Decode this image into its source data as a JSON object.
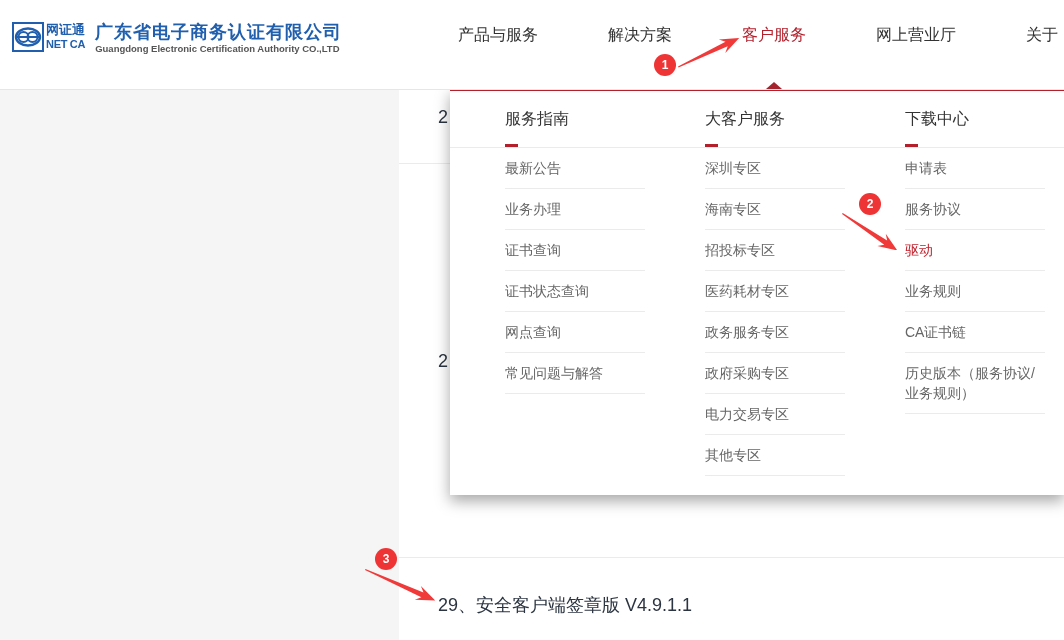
{
  "header": {
    "logo": {
      "mark_cn": "网证通",
      "mark_en": "NET CA",
      "name": "广东省电子商务认证有限公司",
      "name_en": "Guangdong Electronic Certification Authority CO.,LTD"
    },
    "nav": [
      {
        "label": "产品与服务",
        "selected": false
      },
      {
        "label": "解决方案",
        "selected": false
      },
      {
        "label": "客户服务",
        "selected": true
      },
      {
        "label": "网上营业厅",
        "selected": false
      },
      {
        "label": "关于",
        "selected": false
      }
    ]
  },
  "dropdown": {
    "columns": [
      {
        "heading": "服务指南",
        "items": [
          {
            "label": "最新公告",
            "selected": false
          },
          {
            "label": "业务办理",
            "selected": false
          },
          {
            "label": "证书查询",
            "selected": false
          },
          {
            "label": "证书状态查询",
            "selected": false
          },
          {
            "label": "网点查询",
            "selected": false
          },
          {
            "label": "常见问题与解答",
            "selected": false
          }
        ]
      },
      {
        "heading": "大客户服务",
        "items": [
          {
            "label": "深圳专区",
            "selected": false
          },
          {
            "label": "海南专区",
            "selected": false
          },
          {
            "label": "招投标专区",
            "selected": false
          },
          {
            "label": "医药耗材专区",
            "selected": false
          },
          {
            "label": "政务服务专区",
            "selected": false
          },
          {
            "label": "政府采购专区",
            "selected": false
          },
          {
            "label": "电力交易专区",
            "selected": false
          },
          {
            "label": "其他专区",
            "selected": false
          }
        ]
      },
      {
        "heading": "下载中心",
        "items": [
          {
            "label": "申请表",
            "selected": false
          },
          {
            "label": "服务协议",
            "selected": false
          },
          {
            "label": "驱动",
            "selected": true
          },
          {
            "label": "业务规则",
            "selected": false
          },
          {
            "label": "CA证书链",
            "selected": false
          },
          {
            "label": "历史版本（服务协议/业务规则）",
            "selected": false
          }
        ]
      }
    ]
  },
  "content": {
    "items": [
      {
        "title": "2"
      },
      {
        "title": "2"
      },
      {
        "title": "29、安全客户端签章版 V4.9.1.1"
      }
    ]
  },
  "annotations": [
    {
      "number": "1"
    },
    {
      "number": "2"
    },
    {
      "number": "3"
    }
  ]
}
